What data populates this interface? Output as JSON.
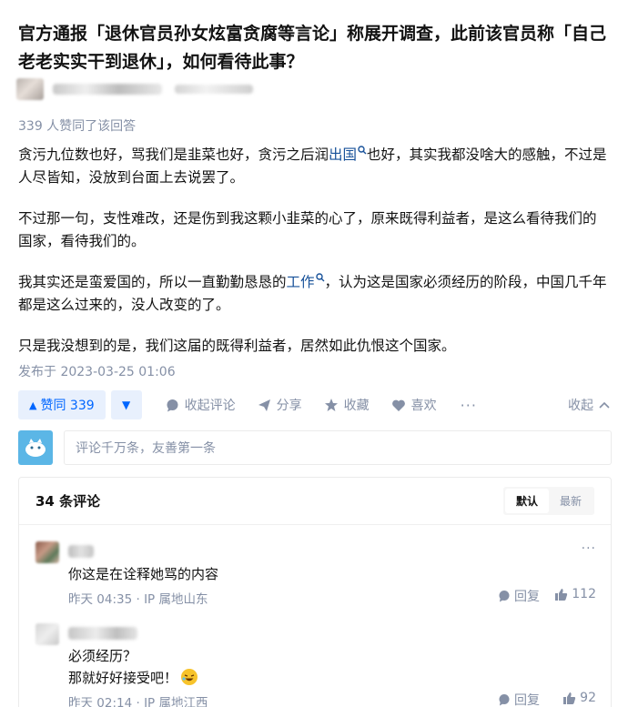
{
  "question": {
    "title": "官方通报「退休官员孙女炫富贪腐等言论」称展开调查，此前该官员称「自己老老实实干到退休」，如何看待此事？"
  },
  "answer": {
    "upvote_summary": "339 人赞同了该回答",
    "paragraphs": [
      [
        "贪污九位数也好，骂我们是韭菜也好，贪污之后润",
        "出国",
        "也好，其实我都没啥大的感触，不过是人尽皆知，没放到台面上去说罢了。"
      ],
      [
        "不过那一句，支性难改，还是伤到我这颗小韭菜的心了，原来既得利益者，是这么看待我们的国家，看待我们的。"
      ],
      [
        "我其实还是蛮爱国的，所以一直勤勤恳恳的",
        "工作",
        "，认为这是国家必须经历的阶段，中国几千年都是这么过来的，没人改变的了。"
      ],
      [
        "只是我没想到的是，我们这届的既得利益者，居然如此仇恨这个国家。"
      ]
    ],
    "published": "发布于 2023-03-25 01:06"
  },
  "actions": {
    "upvote_label": "赞同 339",
    "upvote_arrow": "▲",
    "downvote_arrow": "▼",
    "collapse_comments": "收起评论",
    "share": "分享",
    "favorite": "收藏",
    "like": "喜欢",
    "more": "···",
    "collapse": "收起"
  },
  "comment_box": {
    "placeholder": "评论千万条，友善第一条"
  },
  "comments_panel": {
    "count_label": "34 条评论",
    "sort_default": "默认",
    "sort_latest": "最新",
    "items": [
      {
        "lines": [
          "你这是在诠释她骂的内容"
        ],
        "time_loc": "昨天 04:35 · IP 属地山东",
        "reply": "回复",
        "likes": "112"
      },
      {
        "lines": [
          "必须经历？",
          "那就好好接受吧！"
        ],
        "time_loc": "昨天 02:14 · IP 属地江西",
        "reply": "回复",
        "likes": "92"
      }
    ]
  },
  "colors": {
    "accent_blue": "#0066ff",
    "vote_bg": "#e8f0fd",
    "meta_gray": "#8590a6",
    "link_blue": "#175199"
  }
}
